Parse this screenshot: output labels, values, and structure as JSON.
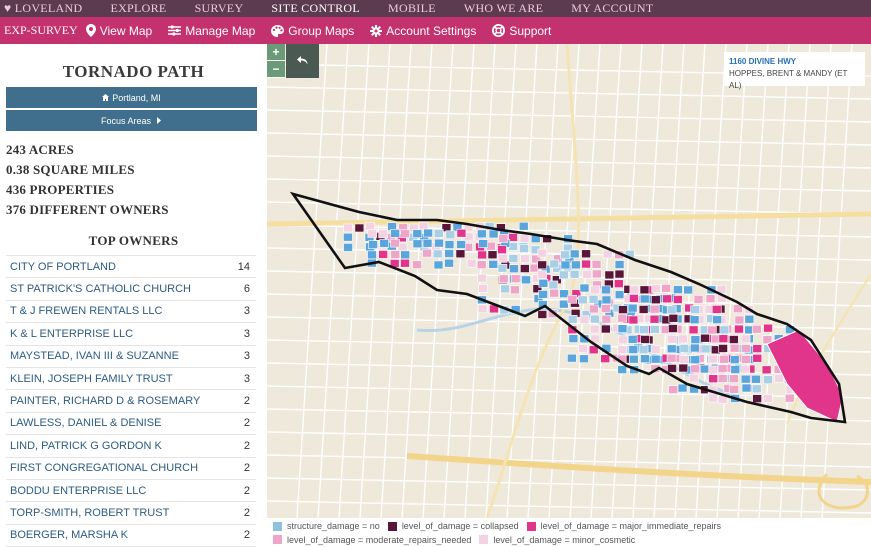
{
  "top_nav": {
    "items": [
      {
        "label": "♥ LOVELAND",
        "active": false
      },
      {
        "label": "EXPLORE",
        "active": false
      },
      {
        "label": "SURVEY",
        "active": false
      },
      {
        "label": "SITE CONTROL",
        "active": true
      },
      {
        "label": "MOBILE",
        "active": false
      },
      {
        "label": "WHO WE ARE",
        "active": false
      },
      {
        "label": "MY ACCOUNT",
        "active": false
      }
    ]
  },
  "sub_nav": {
    "title": "EXP-SURVEY",
    "items": [
      {
        "label": "View Map",
        "icon": "map-pin-icon"
      },
      {
        "label": "Manage Map",
        "icon": "sliders-icon"
      },
      {
        "label": "Group Maps",
        "icon": "palette-icon"
      },
      {
        "label": "Account Settings",
        "icon": "gear-icon"
      },
      {
        "label": "Support",
        "icon": "lifebuoy-icon"
      }
    ]
  },
  "sidebar": {
    "title": "TORNADO PATH",
    "location_button": "Portland, MI",
    "focus_button": "Focus Areas",
    "stats": [
      "243 ACRES",
      "0.38 SQUARE MILES",
      "436 PROPERTIES",
      "376 DIFFERENT OWNERS"
    ],
    "owners_title": "TOP OWNERS",
    "owners": [
      {
        "name": "CITY OF PORTLAND",
        "count": "14"
      },
      {
        "name": "ST PATRICK'S CATHOLIC CHURCH",
        "count": "6"
      },
      {
        "name": "T & J FREWEN RENTALS LLC",
        "count": "3"
      },
      {
        "name": "K & L ENTERPRISE LLC",
        "count": "3"
      },
      {
        "name": "MAYSTEAD, IVAN III & SUZANNE",
        "count": "3"
      },
      {
        "name": "KLEIN, JOSEPH FAMILY TRUST",
        "count": "3"
      },
      {
        "name": "PAINTER, RICHARD D & ROSEMARY",
        "count": "2"
      },
      {
        "name": "LAWLESS, DANIEL & DENISE",
        "count": "2"
      },
      {
        "name": "LIND, PATRICK G GORDON K",
        "count": "2"
      },
      {
        "name": "FIRST CONGREGATIONAL CHURCH",
        "count": "2"
      },
      {
        "name": "BODDU ENTERPRISE LLC",
        "count": "2"
      },
      {
        "name": "TORP-SMITH, ROBERT TRUST",
        "count": "2"
      },
      {
        "name": "BOERGER, MARSHA K",
        "count": "2"
      }
    ]
  },
  "map": {
    "zoom_in": "+",
    "zoom_out": "−",
    "info": {
      "address": "1160 DIVINE HWY",
      "owner": "HOPPES, BRENT & MANDY (ET AL)"
    },
    "colors": {
      "no_damage": "#5aa6dc",
      "light_blue": "#a9cfe6",
      "collapsed": "#5a1638",
      "major": "#e0358a",
      "moderate": "#eea6c8",
      "minor": "#f3d3e1"
    }
  },
  "legend": {
    "items": [
      {
        "label": "structure_damage = no",
        "color": "#8fc0e0"
      },
      {
        "label": "level_of_damage = collapsed",
        "color": "#5a1638"
      },
      {
        "label": "level_of_damage = major_immediate_repairs",
        "color": "#e0358a"
      },
      {
        "label": "level_of_damage = moderate_repairs_needed",
        "color": "#eea6c8"
      },
      {
        "label": "level_of_damage = minor_cosmetic",
        "color": "#f3d3e1"
      }
    ]
  }
}
